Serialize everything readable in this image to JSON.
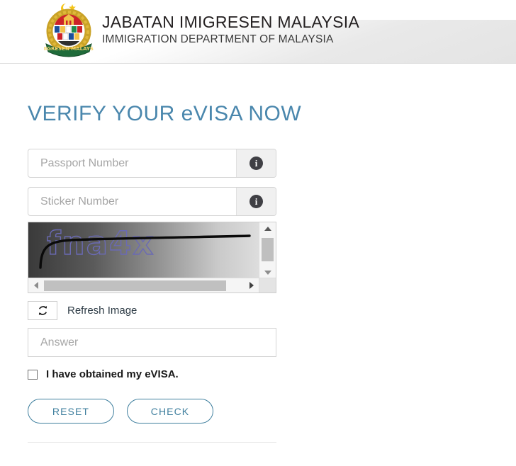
{
  "header": {
    "title_main": "JABATAN IMIGRESEN MALAYSIA",
    "title_sub": "IMMIGRATION DEPARTMENT OF MALAYSIA",
    "crest_icon": "malaysia-immigration-crest-icon",
    "crest_banner_text": "IMIGRESEN MALAYSIA"
  },
  "form": {
    "page_title": "VERIFY YOUR eVISA NOW",
    "passport": {
      "placeholder": "Passport Number",
      "value": "",
      "info_icon": "info-icon",
      "info_glyph": "i"
    },
    "sticker": {
      "placeholder": "Sticker Number",
      "value": "",
      "info_icon": "info-icon",
      "info_glyph": "i"
    },
    "captcha": {
      "text": "fna4x",
      "scroll_up_icon": "triangle-up-icon",
      "scroll_down_icon": "triangle-down-icon",
      "scroll_left_icon": "triangle-left-icon",
      "scroll_right_icon": "triangle-right-icon"
    },
    "refresh": {
      "label": "Refresh Image",
      "icon": "refresh-icon"
    },
    "answer": {
      "placeholder": "Answer",
      "value": ""
    },
    "consent": {
      "label": "I have obtained my eVISA.",
      "checked": false
    },
    "buttons": {
      "reset": "RESET",
      "check": "CHECK"
    }
  },
  "colors": {
    "accent_blue": "#4a87ad",
    "button_blue": "#3f7f9e",
    "captcha_text": "#6a6ab4",
    "header_text": "#231f20"
  }
}
